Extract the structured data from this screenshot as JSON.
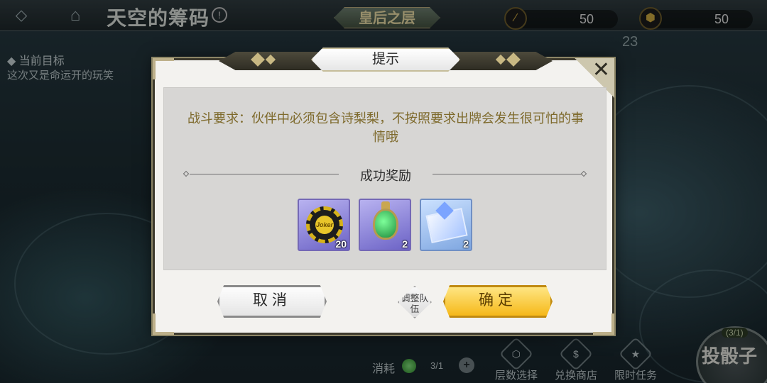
{
  "topbar": {
    "back_icon": "back-arrow-icon",
    "home_icon": "home-icon",
    "title": "天空的筹码",
    "floor_tag": "皇后之层",
    "resource1_value": "50",
    "resource2_value": "50"
  },
  "background": {
    "goal_title": "当前目标",
    "goal_text": "这次又是命运开的玩笑",
    "floor_number": "23"
  },
  "bottombar": {
    "consume_label": "消耗",
    "consume_value": "3/1",
    "items": [
      {
        "label": "层数选择",
        "icon": "floor-select-icon"
      },
      {
        "label": "兑换商店",
        "icon": "shop-icon"
      },
      {
        "label": "限时任务",
        "icon": "star-task-icon"
      }
    ],
    "dice_label": "投骰子",
    "dice_count": "(3/1)"
  },
  "dialog": {
    "title": "提示",
    "requirement": "战斗要求：伙伴中必须包含诗梨梨，不按照要求出牌会发生很可怕的事情哦",
    "rewards_label": "成功奖励",
    "rewards": [
      {
        "name": "joker-chip",
        "count": "20",
        "chip_text": "Joker"
      },
      {
        "name": "green-potion",
        "count": "2"
      },
      {
        "name": "crystal-ticket",
        "count": "2"
      }
    ],
    "cancel_label": "取消",
    "team_label": "调整队伍",
    "confirm_label": "确定"
  },
  "colors": {
    "accent_gold": "#f5b512",
    "requirement_text": "#7e6a2c",
    "dialog_border": "#3d3a2d"
  }
}
